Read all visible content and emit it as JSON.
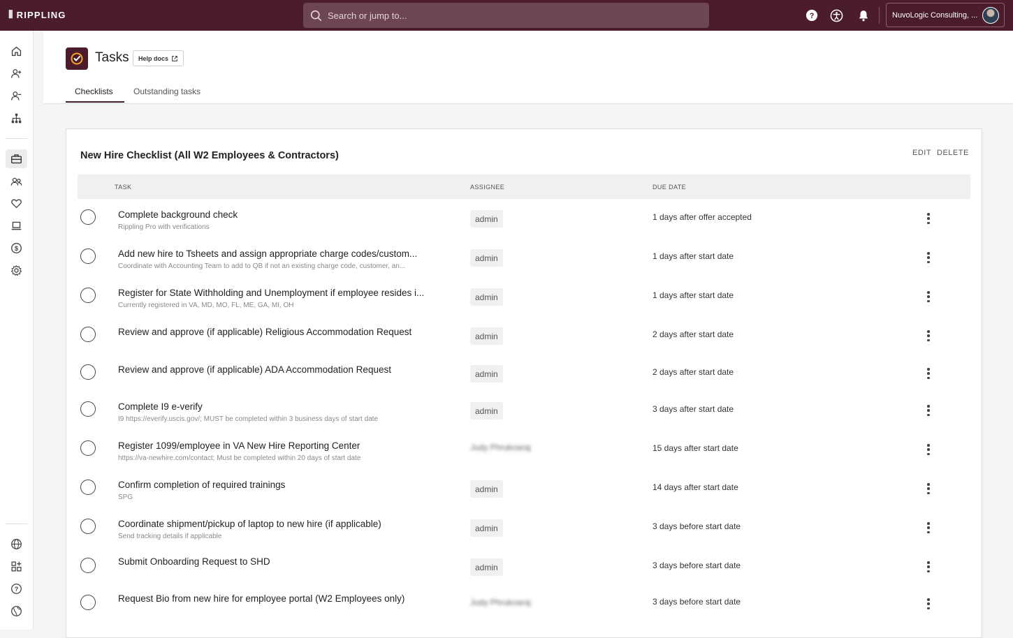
{
  "brand": {
    "name": "RIPPLING"
  },
  "search": {
    "placeholder": "Search or jump to..."
  },
  "account": {
    "name": "NuvoLogic Consulting, ..."
  },
  "page": {
    "title": "Tasks",
    "help_label": "Help docs"
  },
  "tabs": [
    {
      "label": "Checklists",
      "active": true
    },
    {
      "label": "Outstanding tasks",
      "active": false
    }
  ],
  "checklist": {
    "title": "New Hire Checklist (All W2 Employees & Contractors)",
    "edit_label": "EDIT",
    "delete_label": "DELETE",
    "columns": {
      "task": "TASK",
      "assignee": "ASSIGNEE",
      "due": "DUE DATE"
    },
    "rows": [
      {
        "title": "Complete background check",
        "subtitle": "Rippling Pro with verifications",
        "assignee": "admin",
        "due": "1 days after offer accepted"
      },
      {
        "title": "Add new hire to Tsheets and assign appropriate charge codes/custom...",
        "subtitle": "Coordinate with Accounting Team to add to QB if not an existing charge code, customer, an...",
        "assignee": "admin",
        "due": "1 days after start date"
      },
      {
        "title": "Register for State Withholding and Unemployment if employee resides i...",
        "subtitle": "Currently registered in VA, MD, MO, FL, ME, GA, MI, OH",
        "assignee": "admin",
        "due": "1 days after start date"
      },
      {
        "title": "Review and approve (if applicable) Religious Accommodation Request",
        "subtitle": "",
        "assignee": "admin",
        "due": "2 days after start date"
      },
      {
        "title": "Review and approve (if applicable) ADA Accommodation Request",
        "subtitle": "",
        "assignee": "admin",
        "due": "2 days after start date"
      },
      {
        "title": "Complete I9 e-verify",
        "subtitle": "I9 https://everify.uscis.gov/; MUST be completed within 3 business days of start date",
        "assignee": "admin",
        "due": "3 days after start date"
      },
      {
        "title": "Register 1099/employee in VA New Hire Reporting Center",
        "subtitle": "https://va-newhire.com/contact; Must be completed within 20 days of start date",
        "assignee": "Judy Phrukoaraj",
        "due": "15 days after start date"
      },
      {
        "title": "Confirm completion of required trainings",
        "subtitle": "SPG",
        "assignee": "admin",
        "due": "14 days after start date"
      },
      {
        "title": "Coordinate shipment/pickup of laptop to new hire (if applicable)",
        "subtitle": "Send tracking details if applicable",
        "assignee": "admin",
        "due": "3 days before start date"
      },
      {
        "title": "Submit Onboarding Request to SHD",
        "subtitle": "",
        "assignee": "admin",
        "due": "3 days before start date"
      },
      {
        "title": "Request Bio from new hire for employee portal (W2 Employees only)",
        "subtitle": "",
        "assignee": "Judy Phrukoaraj",
        "due": "3 days before start date"
      }
    ]
  },
  "colors": {
    "topbar": "#4a1c2c",
    "accent": "#f5a623"
  }
}
